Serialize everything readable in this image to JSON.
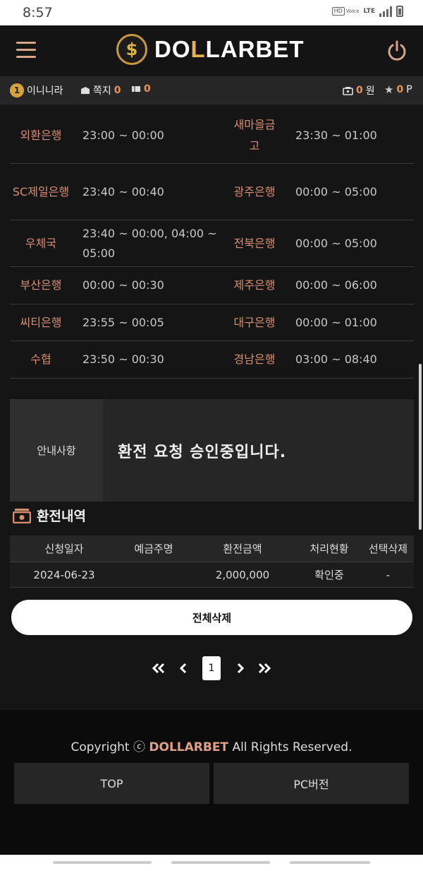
{
  "status": {
    "time": "8:57",
    "hd": "HD",
    "voice": "Voice",
    "lte": "LTE"
  },
  "header": {
    "logo_coin": "$",
    "logo_part1": "DO",
    "logo_gold": "L",
    "logo_part2": "LARBET"
  },
  "userbar": {
    "level": "1",
    "username": "이니니라",
    "msg_label": "쪽지",
    "msg_count": "0",
    "coupon_count": "0",
    "money": "0",
    "money_unit": "원",
    "points": "0",
    "points_unit": "P"
  },
  "banks": [
    {
      "left_name": "외환은행",
      "left_time": "23:00 ~ 00:00",
      "right_name": "새마을금고",
      "right_time": "23:30 ~ 01:00"
    },
    {
      "left_name": "SC제일은행",
      "left_time": "23:40 ~ 00:40",
      "right_name": "광주은행",
      "right_time": "00:00 ~ 05:00"
    },
    {
      "left_name": "우체국",
      "left_time": "23:40 ~ 00:00, 04:00 ~ 05:00",
      "right_name": "전북은행",
      "right_time": "00:00 ~ 05:00"
    },
    {
      "left_name": "부산은행",
      "left_time": "00:00 ~ 00:30",
      "right_name": "제주은행",
      "right_time": "00:00 ~ 06:00"
    },
    {
      "left_name": "씨티은행",
      "left_time": "23:55 ~ 00:05",
      "right_name": "대구은행",
      "right_time": "00:00 ~ 01:00"
    },
    {
      "left_name": "수협",
      "left_time": "23:50 ~ 00:30",
      "right_name": "경남은행",
      "right_time": "03:00 ~ 08:40"
    }
  ],
  "notice": {
    "label": "안내사항",
    "message": "환전 요청 승인중입니다."
  },
  "history": {
    "title": "환전내역",
    "headers": [
      "신청일자",
      "예금주명",
      "환전금액",
      "처리현황",
      "선택삭제"
    ],
    "rows": [
      [
        "2024-06-23",
        "",
        "2,000,000",
        "확인중",
        "-"
      ]
    ]
  },
  "delete_all_label": "전체삭제",
  "pagination": {
    "current": "1"
  },
  "footer": {
    "copy_prefix": "Copyright",
    "copy_symbol": "ⓒ",
    "brand": "DOLLARBET",
    "copy_suffix": "All Rights Reserved.",
    "top_label": "TOP",
    "pc_label": "PC버전"
  },
  "colors": {
    "accent": "#d88e72",
    "gold": "#e6b04a",
    "orange": "#e9925a",
    "bg": "#151515"
  }
}
